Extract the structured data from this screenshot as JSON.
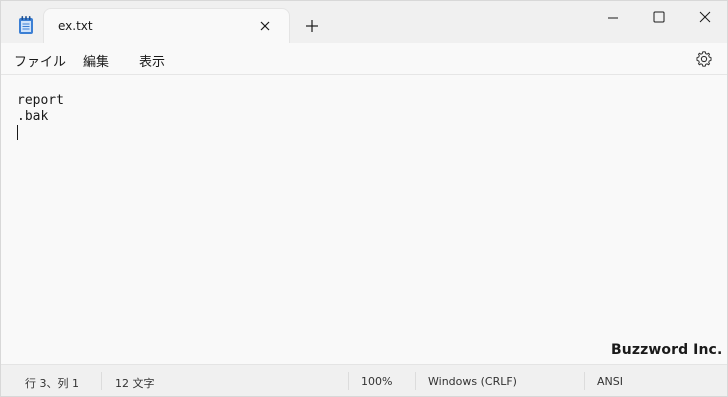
{
  "tab": {
    "title": "ex.txt"
  },
  "menu": {
    "file": "ファイル",
    "edit": "編集",
    "view": "表示"
  },
  "editor": {
    "lines": [
      "report",
      ".bak",
      ""
    ]
  },
  "watermark": "Buzzword Inc.",
  "status": {
    "position": "行 3、列 1",
    "char_count": "12 文字",
    "zoom": "100%",
    "line_ending": "Windows (CRLF)",
    "encoding": "ANSI"
  },
  "icons": {
    "app": "notepad-icon",
    "tab_close": "close-icon",
    "new_tab": "plus-icon",
    "minimize": "minimize-icon",
    "maximize": "maximize-icon",
    "close": "close-icon",
    "settings": "gear-icon"
  },
  "colors": {
    "app_icon": "#3b7fd4",
    "background": "#f9f9f9",
    "titlebar": "#f0f0f0"
  }
}
